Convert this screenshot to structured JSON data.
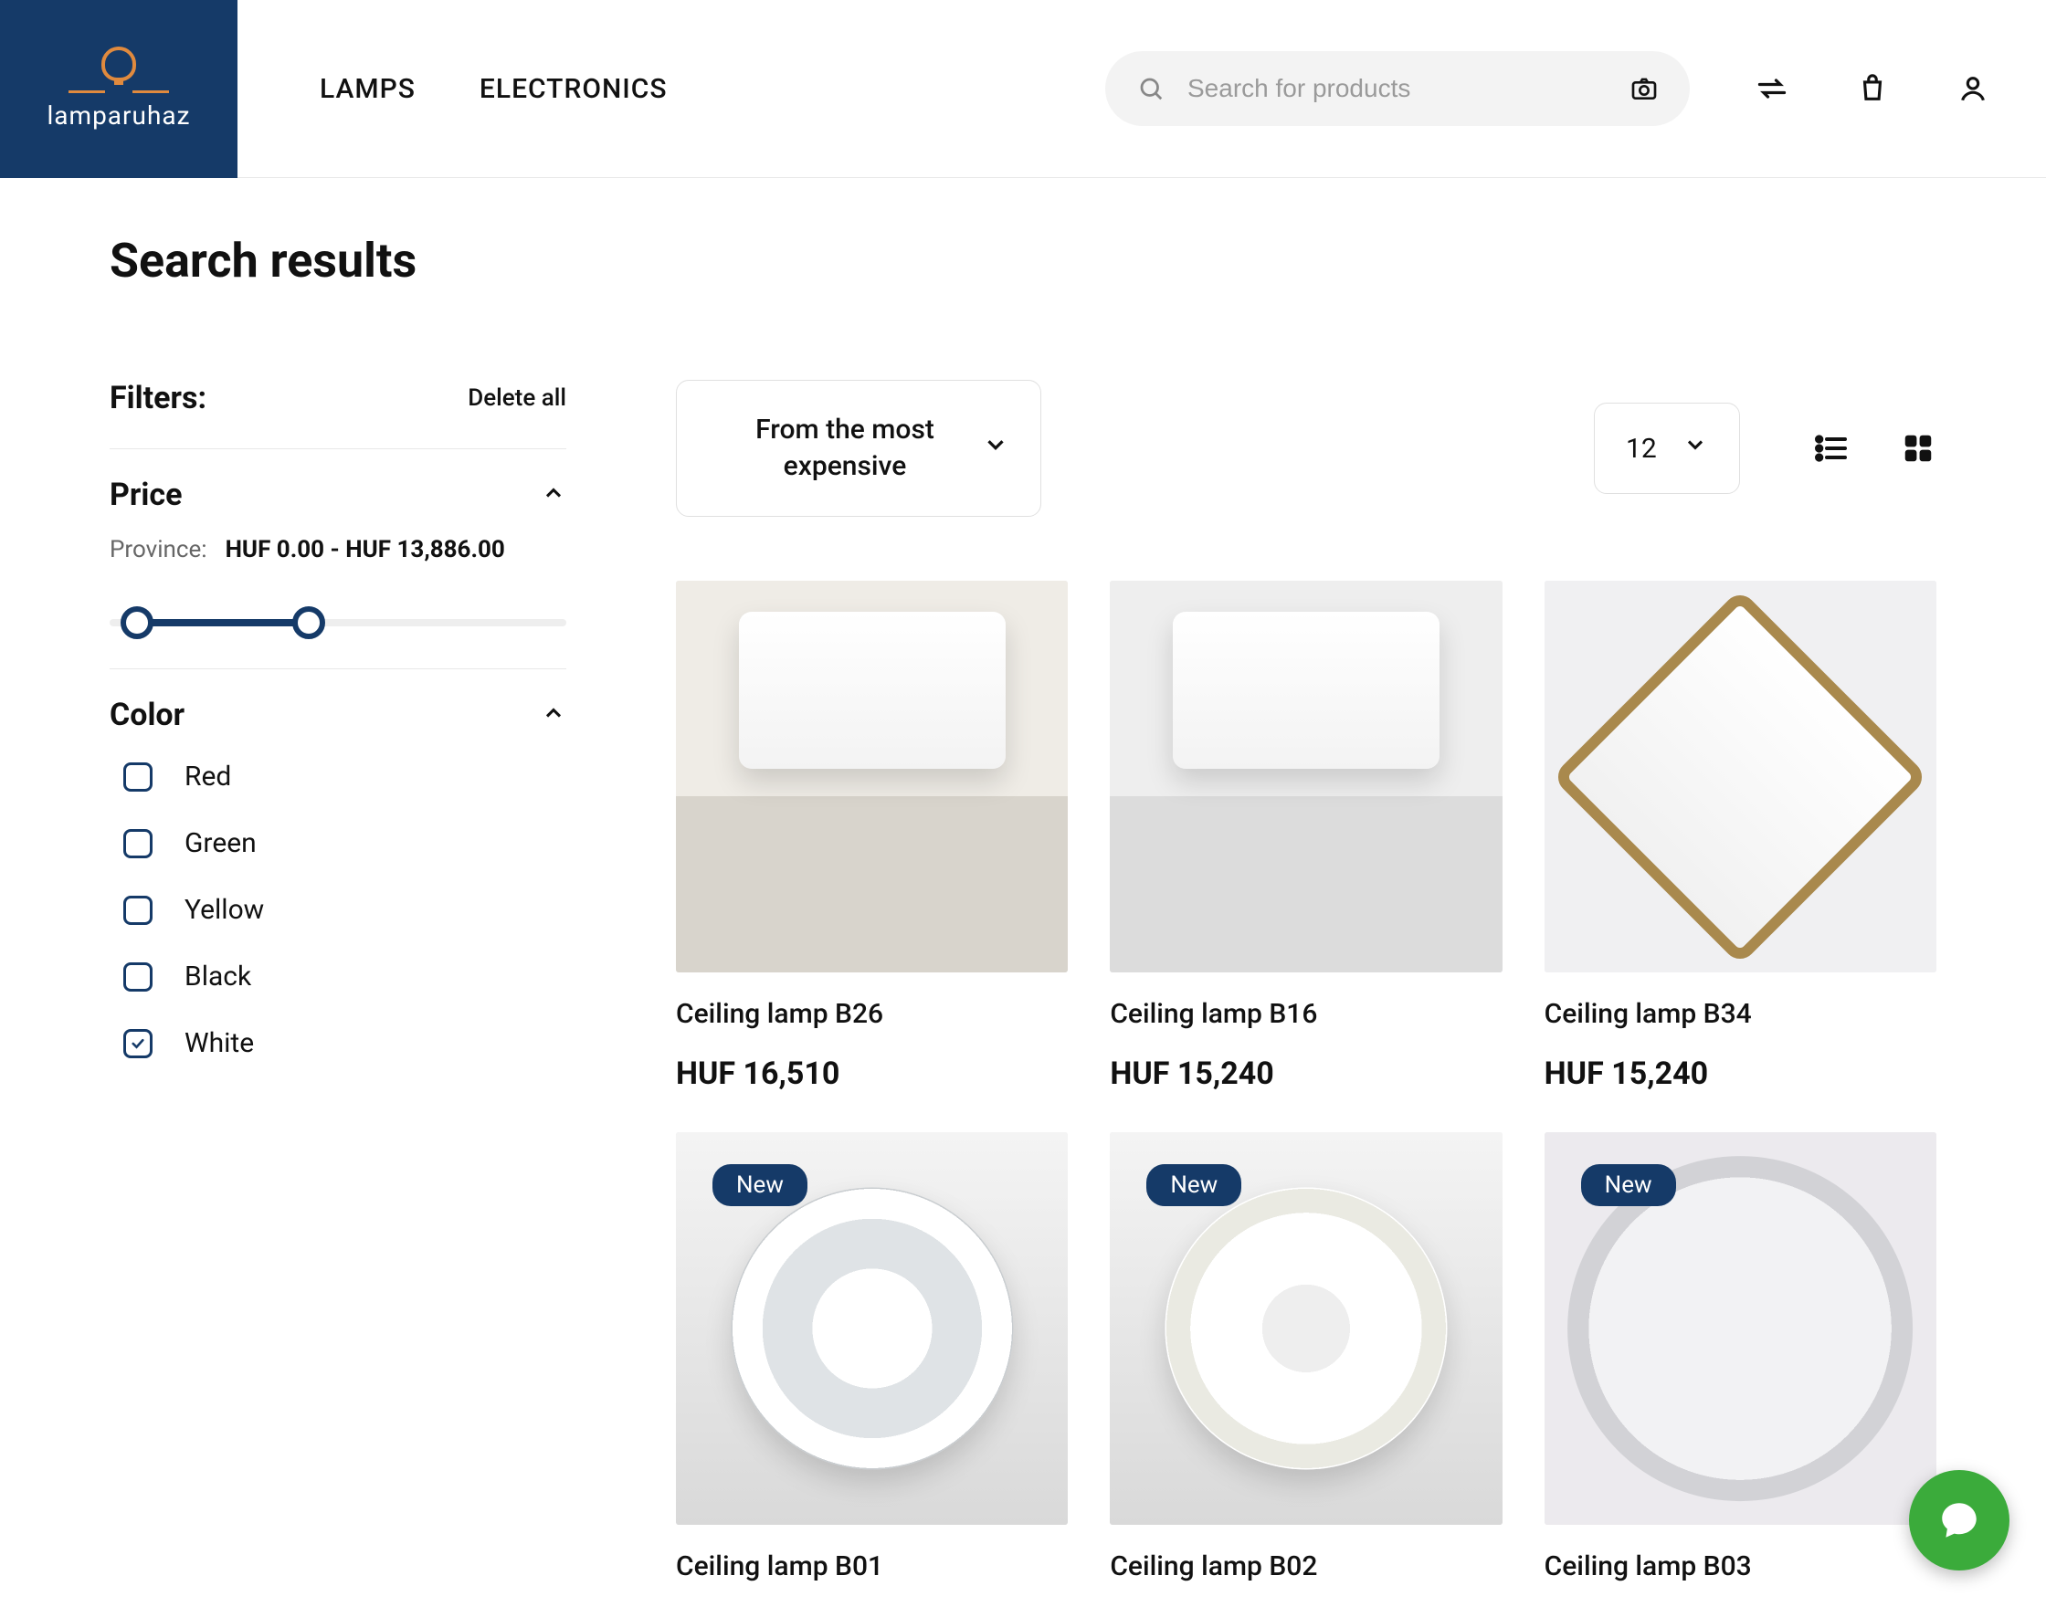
{
  "brand": "lamparuhaz",
  "nav": {
    "lamps": "LAMPS",
    "electronics": "ELECTRONICS"
  },
  "search": {
    "placeholder": "Search for products"
  },
  "page": {
    "title": "Search results"
  },
  "filters": {
    "title": "Filters:",
    "delete_all": "Delete all",
    "price": {
      "label": "Price",
      "province_label": "Province:",
      "range_text": "HUF 0.00 - HUF 13,886.00"
    },
    "color": {
      "label": "Color",
      "options": [
        {
          "label": "Red",
          "checked": false
        },
        {
          "label": "Green",
          "checked": false
        },
        {
          "label": "Yellow",
          "checked": false
        },
        {
          "label": "Black",
          "checked": false
        },
        {
          "label": "White",
          "checked": true
        }
      ]
    }
  },
  "toolbar": {
    "sort": "From the most expensive",
    "page_size": "12"
  },
  "products": [
    {
      "name": "Ceiling lamp B26",
      "price": "HUF 16,510",
      "badge": null,
      "img": "sq-room"
    },
    {
      "name": "Ceiling lamp B16",
      "price": "HUF 15,240",
      "badge": null,
      "img": "sq-room2"
    },
    {
      "name": "Ceiling lamp B34",
      "price": "HUF 15,240",
      "badge": null,
      "img": "diamond"
    },
    {
      "name": "Ceiling lamp B01",
      "price": "",
      "badge": "New",
      "img": "circ1"
    },
    {
      "name": "Ceiling lamp B02",
      "price": "",
      "badge": "New",
      "img": "circ2"
    },
    {
      "name": "Ceiling lamp B03",
      "price": "",
      "badge": "New",
      "img": "circ3"
    }
  ]
}
